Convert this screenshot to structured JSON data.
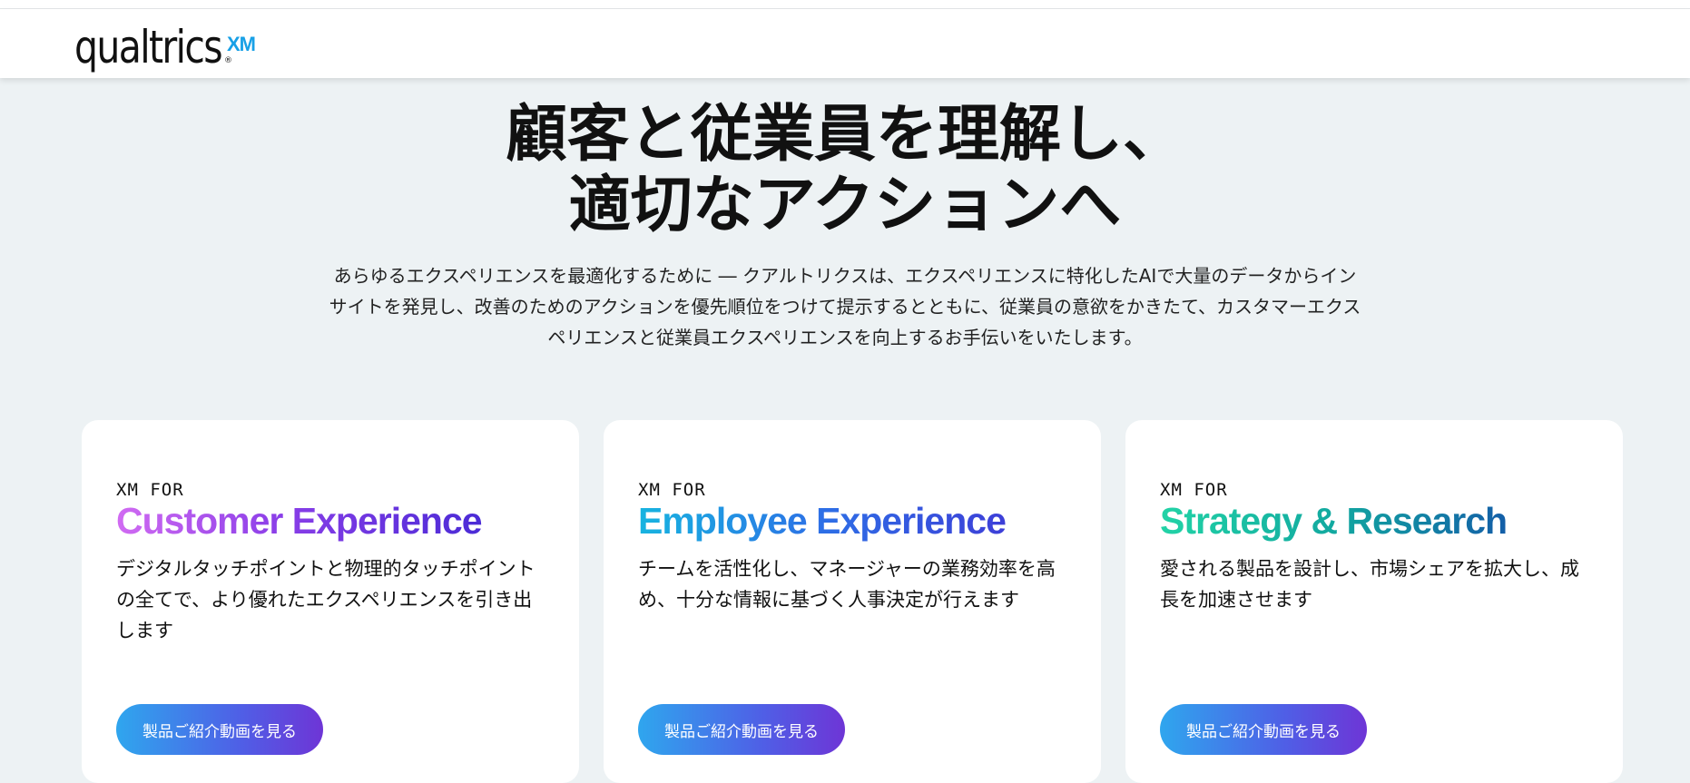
{
  "header": {
    "logo_text": "qualtrics",
    "logo_suffix": "XM",
    "logo_reg": "®"
  },
  "hero": {
    "title_line1": "顧客と従業員を理解し、",
    "title_line2": "適切なアクションへ",
    "description": "あらゆるエクスペリエンスを最適化するために ― クアルトリクスは、エクスペリエンスに特化したAIで大量のデータからインサイトを発見し、改善のためのアクションを優先順位をつけて提示するとともに、従業員の意欲をかきたて、カスタマーエクスペリエンスと従業員エクスペリエンスを向上するお手伝いをいたします。"
  },
  "cards": [
    {
      "eyebrow": "XM FOR",
      "title": "Customer Experience",
      "description": "デジタルタッチポイントと物理的タッチポイントの全てで、より優れたエクスペリエンスを引き出します",
      "button": "製品ご紹介動画を見る"
    },
    {
      "eyebrow": "XM FOR",
      "title": "Employee Experience",
      "description": "チームを活性化し、マネージャーの業務効率を高め、十分な情報に基づく人事決定が行えます",
      "button": "製品ご紹介動画を見る"
    },
    {
      "eyebrow": "XM FOR",
      "title": "Strategy & Research",
      "description": "愛される製品を設計し、市場シェアを拡大し、成長を加速させます",
      "button": "製品ご紹介動画を見る"
    }
  ],
  "colors": {
    "background": "#edf2f4",
    "logo_accent": "#18a0e6",
    "button_gradient_start": "#2fa6ee",
    "button_gradient_end": "#6e35d6"
  }
}
